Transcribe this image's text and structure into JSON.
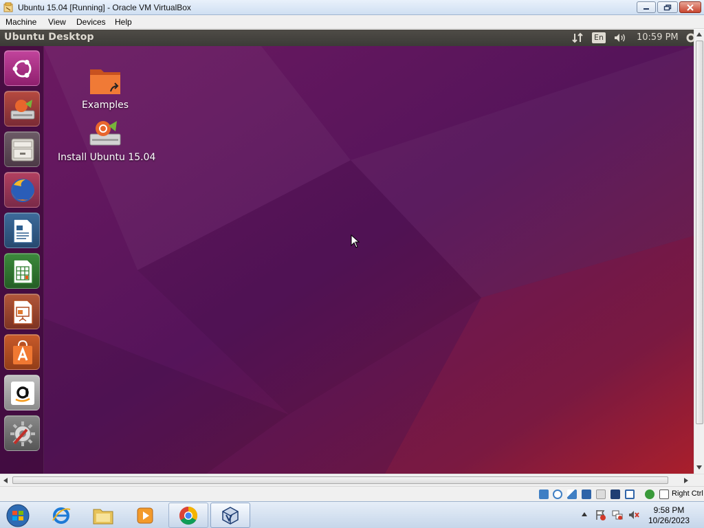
{
  "host_window": {
    "title": "Ubuntu 15.04 [Running] - Oracle VM VirtualBox",
    "menu": [
      "Machine",
      "View",
      "Devices",
      "Help"
    ]
  },
  "guest": {
    "topbar": {
      "title": "Ubuntu Desktop",
      "language": "En",
      "clock": "10:59 PM",
      "indicators": [
        "network-icon",
        "keyboard-language",
        "volume-icon",
        "clock",
        "system-gear-icon"
      ]
    },
    "launcher": [
      "ubuntu-dash-icon",
      "install-ubuntu-icon",
      "file-manager-icon",
      "firefox-icon",
      "libreoffice-writer-icon",
      "libreoffice-calc-icon",
      "libreoffice-impress-icon",
      "software-center-icon",
      "amazon-icon",
      "system-settings-icon"
    ],
    "desktop_icons": [
      {
        "label": "Examples",
        "icon": "folder-link-icon"
      },
      {
        "label": "Install Ubuntu 15.04",
        "icon": "install-drive-icon"
      }
    ],
    "colors": {
      "bg_top": "#6e1a62",
      "bg_mid": "#551556",
      "bg_corner": "#9b1a2c",
      "panel": "#3c3b37",
      "launcher": "#3e0a3a"
    }
  },
  "vbox_status": {
    "host_key": "Right Ctrl",
    "icons": [
      "hard-disk-icon",
      "optical-drive-icon",
      "audio-icon",
      "network-icon",
      "usb-icon",
      "shared-folders-icon",
      "display-icon",
      "video-capture-icon",
      "mouse-integration-icon",
      "host-key-arrow-icon"
    ]
  },
  "taskbar": {
    "time": "9:58 PM",
    "date": "10/26/2023",
    "apps": [
      "internet-explorer-icon",
      "windows-explorer-icon",
      "media-player-icon",
      "chrome-icon",
      "virtualbox-icon"
    ]
  }
}
